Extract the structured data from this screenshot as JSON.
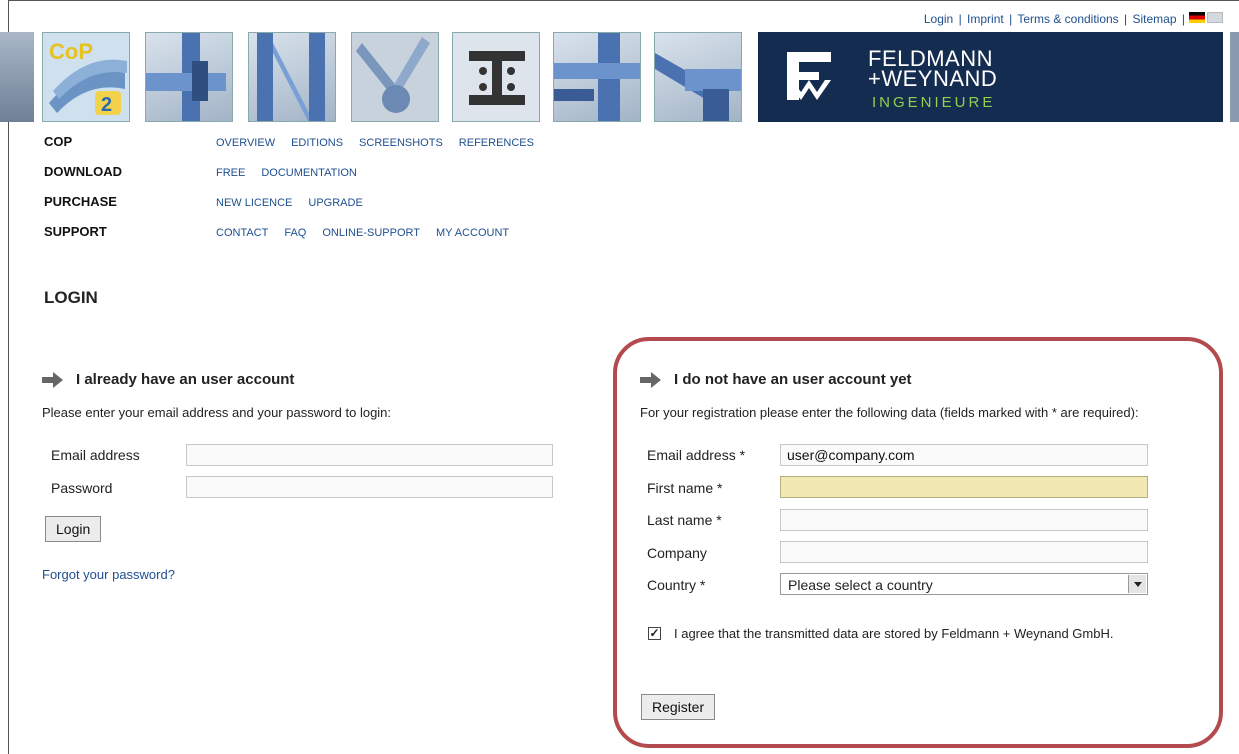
{
  "top_links": {
    "login": "Login",
    "imprint": "Imprint",
    "terms": "Terms & conditions",
    "sitemap": "Sitemap",
    "sep": "|"
  },
  "banner": {
    "logo_line1": "FELDMANN",
    "logo_line2": "+WEYNAND",
    "logo_sub": "INGENIEURE",
    "cop_label": "CoP",
    "cop_version": "2"
  },
  "menu": [
    {
      "title": "COP",
      "subs": [
        "OVERVIEW",
        "EDITIONS",
        "SCREENSHOTS",
        "REFERENCES"
      ]
    },
    {
      "title": "DOWNLOAD",
      "subs": [
        "FREE",
        "DOCUMENTATION"
      ]
    },
    {
      "title": "PURCHASE",
      "subs": [
        "NEW LICENCE",
        "UPGRADE"
      ]
    },
    {
      "title": "SUPPORT",
      "subs": [
        "CONTACT",
        "FAQ",
        "ONLINE-SUPPORT",
        "MY ACCOUNT"
      ]
    }
  ],
  "page_title": "LOGIN",
  "login_section": {
    "heading": "I already have an user account",
    "intro": "Please enter your email address and your password to login:",
    "email_label": "Email address",
    "email_value": "",
    "password_label": "Password",
    "password_value": "",
    "login_button": "Login",
    "forgot_link": "Forgot your password?"
  },
  "register_section": {
    "heading": "I do not have an user account yet",
    "intro": "For your registration please enter the following data (fields marked with * are required):",
    "email_label": "Email address *",
    "email_value": "user@company.com",
    "first_name_label": "First name *",
    "first_name_value": "",
    "last_name_label": "Last name *",
    "last_name_value": "",
    "company_label": "Company",
    "company_value": "",
    "country_label": "Country *",
    "country_value": "Please select a country",
    "agree_checked": true,
    "agree_text": "I agree that the transmitted data are stored by Feldmann + Weynand GmbH.",
    "register_button": "Register"
  },
  "colors": {
    "link": "#1f4f8f",
    "logo_bg": "#142c4f",
    "logo_accent": "#8fd14f",
    "highlight": "#b34a4e",
    "field_highlight": "#f1e8b4"
  }
}
